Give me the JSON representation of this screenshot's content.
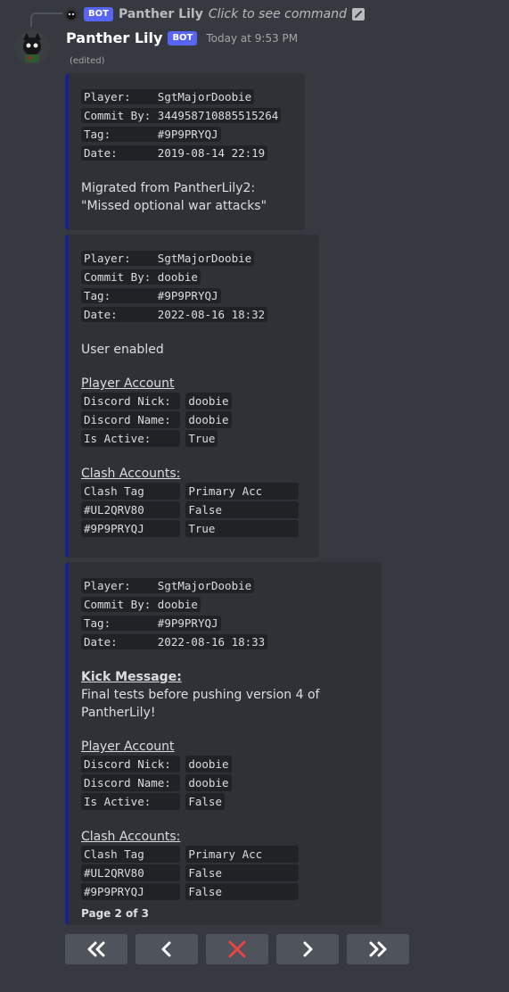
{
  "reply": {
    "bot_tag": "BOT",
    "name": "Panther Lily",
    "command_text": "Click to see command"
  },
  "message": {
    "author": "Panther Lily",
    "bot_tag": "BOT",
    "timestamp": "Today at 9:53 PM",
    "edited": "(edited)"
  },
  "colors": {
    "embed_accent": "#1b1f8a",
    "bot_tag": "#5865f2",
    "cancel": "#ed4245"
  },
  "embeds": [
    {
      "fields": [
        {
          "key": "Player:    ",
          "value": "SgtMajorDoobie"
        },
        {
          "key": "Commit By: ",
          "value": "344958710885515264"
        },
        {
          "key": "Tag:       ",
          "value": "#9P9PRYQJ"
        },
        {
          "key": "Date:      ",
          "value": "2019-08-14 22:19"
        }
      ],
      "note_line1": "Migrated from PantherLily2:",
      "note_line2": "\"Missed optional war attacks\""
    },
    {
      "fields": [
        {
          "key": "Player:    ",
          "value": "SgtMajorDoobie"
        },
        {
          "key": "Commit By: ",
          "value": "doobie"
        },
        {
          "key": "Tag:       ",
          "value": "#9P9PRYQJ"
        },
        {
          "key": "Date:      ",
          "value": "2022-08-16 18:32"
        }
      ],
      "note": "User enabled",
      "player_account_title": "Player Account",
      "player_account": [
        {
          "key": "Discord Nick: ",
          "value": "doobie"
        },
        {
          "key": "Discord Name: ",
          "value": "doobie"
        },
        {
          "key": "Is Active:    ",
          "value": "True"
        }
      ],
      "clash_title": "Clash Accounts:",
      "clash_headers": [
        "Clash Tag     ",
        "Primary Acc     "
      ],
      "clash_rows": [
        [
          "#UL2QRV80     ",
          "False           "
        ],
        [
          "#9P9PRYQJ     ",
          "True            "
        ]
      ]
    },
    {
      "fields": [
        {
          "key": "Player:    ",
          "value": "SgtMajorDoobie"
        },
        {
          "key": "Commit By: ",
          "value": "doobie"
        },
        {
          "key": "Tag:       ",
          "value": "#9P9PRYQJ"
        },
        {
          "key": "Date:      ",
          "value": "2022-08-16 18:33"
        }
      ],
      "kick_title": "Kick Message:",
      "kick_message": "Final tests before pushing version 4 of PantherLily!",
      "player_account_title": "Player Account",
      "player_account": [
        {
          "key": "Discord Nick: ",
          "value": "doobie"
        },
        {
          "key": "Discord Name: ",
          "value": "doobie"
        },
        {
          "key": "Is Active:    ",
          "value": "False"
        }
      ],
      "clash_title": "Clash Accounts:",
      "clash_headers": [
        "Clash Tag     ",
        "Primary Acc     "
      ],
      "clash_rows": [
        [
          "#UL2QRV80     ",
          "False           "
        ],
        [
          "#9P9PRYQJ     ",
          "False           "
        ]
      ],
      "footer": "Page 2 of 3"
    }
  ],
  "buttons": [
    {
      "name": "first-page-button",
      "icon": "double-chevron-left-icon"
    },
    {
      "name": "previous-page-button",
      "icon": "chevron-left-icon"
    },
    {
      "name": "close-button",
      "icon": "close-icon"
    },
    {
      "name": "next-page-button",
      "icon": "chevron-right-icon"
    },
    {
      "name": "last-page-button",
      "icon": "double-chevron-right-icon"
    }
  ]
}
